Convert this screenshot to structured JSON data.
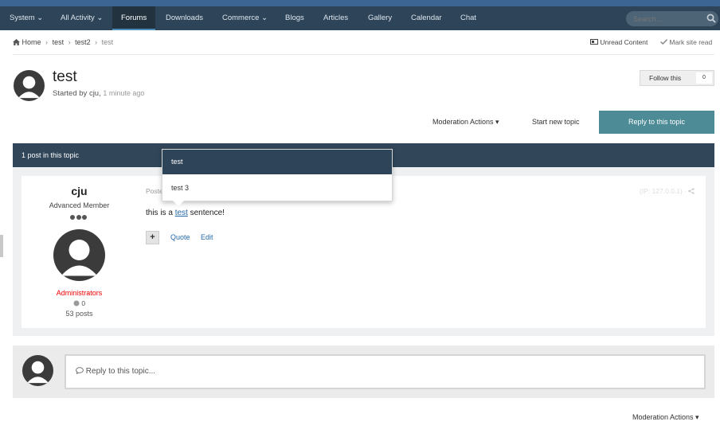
{
  "nav": {
    "items": [
      {
        "label": "System ⌄"
      },
      {
        "label": "All Activity ⌄"
      },
      {
        "label": "Forums"
      },
      {
        "label": "Downloads"
      },
      {
        "label": "Commerce ⌄"
      },
      {
        "label": "Blogs"
      },
      {
        "label": "Articles"
      },
      {
        "label": "Gallery"
      },
      {
        "label": "Calendar"
      },
      {
        "label": "Chat"
      }
    ],
    "search_placeholder": "Search...",
    "active_item": "Forums"
  },
  "breadcrumb": {
    "home": "Home",
    "items": [
      "test",
      "test2",
      "test"
    ],
    "sep": "›"
  },
  "top_actions": {
    "unread": "Unread Content",
    "mark_read": "Mark site read"
  },
  "topic": {
    "title": "test",
    "started_by": "Started by cju,",
    "time": "1 minute ago",
    "follow_label": "Follow this",
    "follow_count": "0"
  },
  "actions": {
    "moderation": "Moderation Actions ▾",
    "start_new": "Start new topic",
    "reply": "Reply to this topic"
  },
  "post_bar": {
    "count_text": "1 post in this topic"
  },
  "post": {
    "author_name": "cju",
    "author_rank": "Advanced Member",
    "author_group": "Administrators",
    "reputation": "0",
    "post_count": "53 posts",
    "posted_label": "Poste",
    "ip": "(IP: 127.0.0.1) · ",
    "text_before": "this is a ",
    "text_link": "test",
    "text_after": " sentence!",
    "plus": "+",
    "quote": "Quote",
    "edit": "Edit"
  },
  "dropdown": {
    "items": [
      "test",
      "test 3"
    ]
  },
  "reply_box": {
    "placeholder": "Reply to this topic..."
  },
  "bottom": {
    "moderation": "Moderation Actions ▾"
  },
  "colors": {
    "navbar": "#2e4458",
    "reply_button": "#4d8b96",
    "link": "#2469a6",
    "admin_group": "#e00000"
  }
}
